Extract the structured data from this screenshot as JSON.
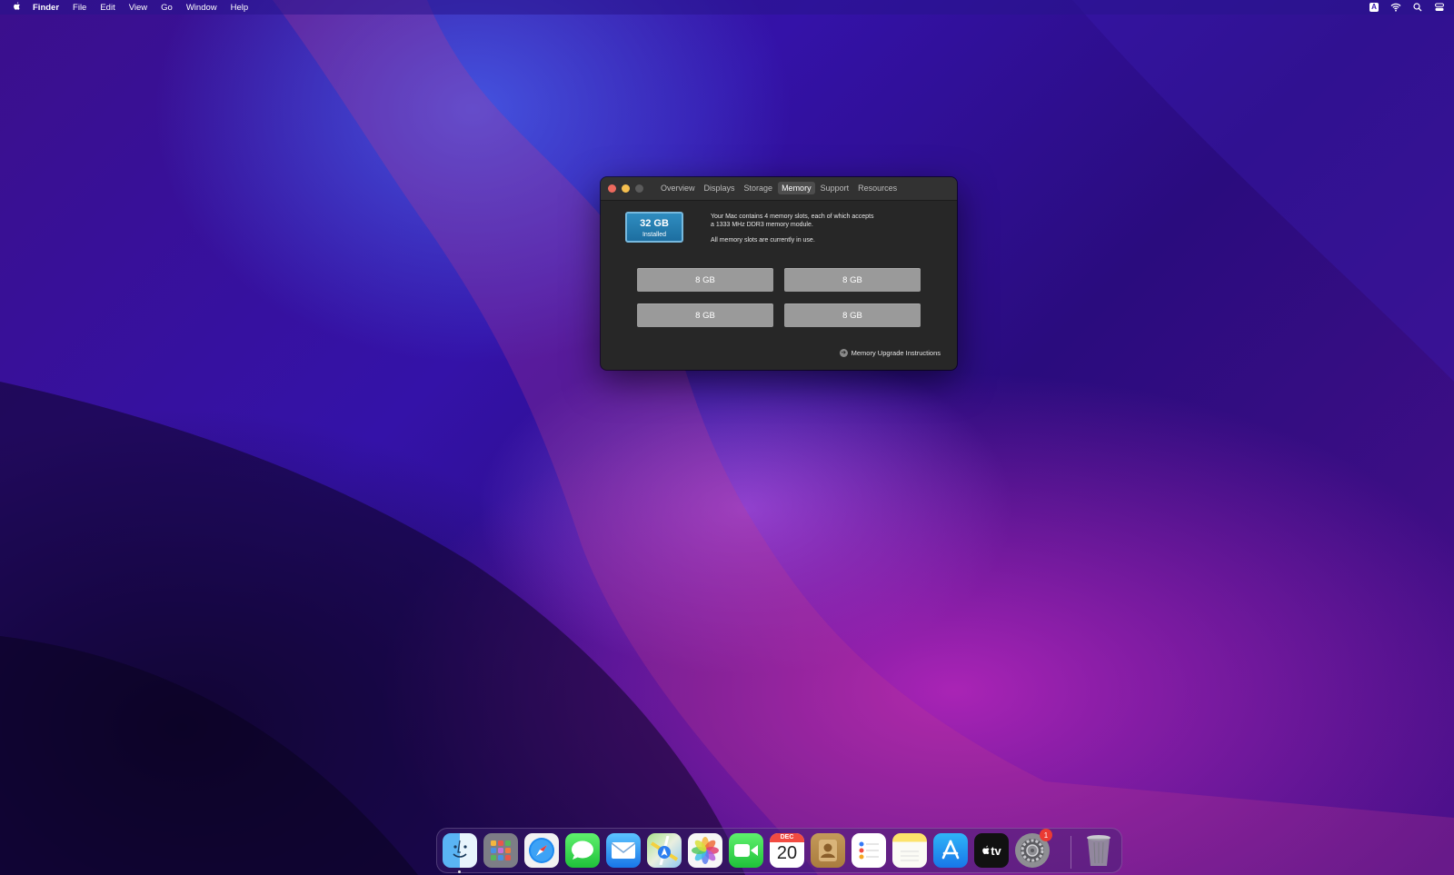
{
  "menubar": {
    "apple_icon": "apple-icon",
    "app_name": "Finder",
    "items": [
      "File",
      "Edit",
      "View",
      "Go",
      "Window",
      "Help"
    ],
    "status_icons": [
      "keyboard-input-icon",
      "wifi-icon",
      "spotlight-search-icon",
      "control-center-icon"
    ],
    "input_indicator": "A"
  },
  "window": {
    "tabs": [
      {
        "label": "Overview",
        "active": false
      },
      {
        "label": "Displays",
        "active": false
      },
      {
        "label": "Storage",
        "active": false
      },
      {
        "label": "Memory",
        "active": true
      },
      {
        "label": "Support",
        "active": false
      },
      {
        "label": "Resources",
        "active": false
      }
    ],
    "installed": {
      "size": "32 GB",
      "label": "Installed"
    },
    "description_line1": "Your Mac contains 4 memory slots, each of which accepts",
    "description_line2": "a 1333 MHz DDR3 memory module.",
    "status": "All memory slots are currently in use.",
    "slots": [
      "8 GB",
      "8 GB",
      "8 GB",
      "8 GB"
    ],
    "upgrade_link": "Memory Upgrade Instructions"
  },
  "dock": {
    "apps": [
      "Finder",
      "Launchpad",
      "Safari",
      "Messages",
      "Mail",
      "Maps",
      "Photos",
      "FaceTime",
      "Calendar",
      "Contacts",
      "Reminders",
      "Notes",
      "App Store",
      "TV",
      "System Preferences",
      "Trash"
    ],
    "calendar": {
      "month": "DEC",
      "day": "20"
    },
    "tv_label": "tv",
    "system_preferences_badge": "1"
  },
  "colors": {
    "accent_blue": "#1d6ea0",
    "slot_gray": "#9a9a9a",
    "window_bg": "#272727"
  }
}
